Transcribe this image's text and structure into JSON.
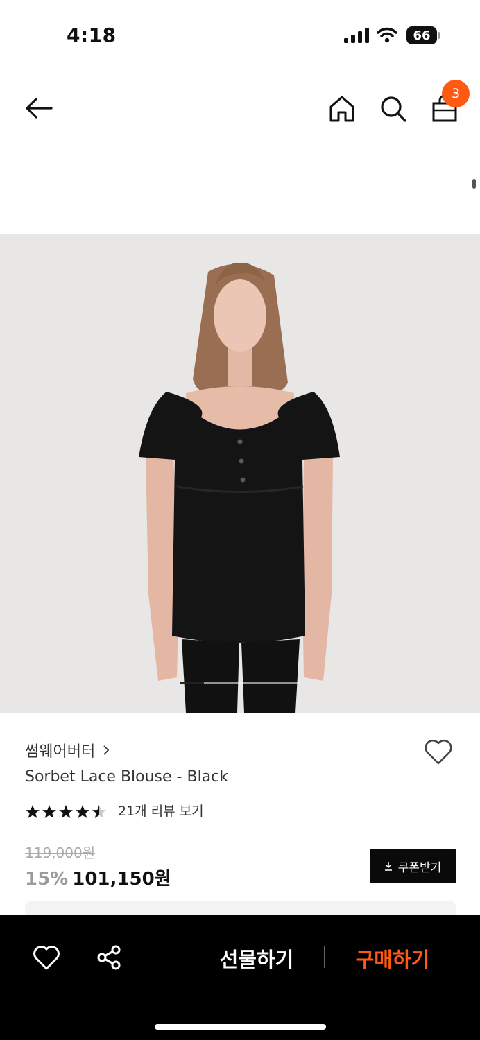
{
  "status_bar": {
    "time": "4:18",
    "battery": "66"
  },
  "header": {
    "cart_count": "3",
    "icons": [
      "back-arrow-icon",
      "home-icon",
      "search-icon",
      "shopping-bag-icon"
    ]
  },
  "product": {
    "brand": "썸웨어버터",
    "title": "Sorbet Lace Blouse - Black",
    "rating": 4.5,
    "review_link": "21개 리뷰 보기",
    "original_price": "119,000원",
    "discount": "15%",
    "sale_price": "101,150원",
    "coupon_label": "쿠폰받기",
    "image_page": {
      "current": 1,
      "fraction_shown": 0.2
    }
  },
  "bottom_bar": {
    "gift_label": "선물하기",
    "buy_label": "구매하기"
  },
  "colors": {
    "accent": "#ff5a14",
    "bottom_bar_bg": "#000000",
    "image_bg": "#e9e7e5"
  }
}
